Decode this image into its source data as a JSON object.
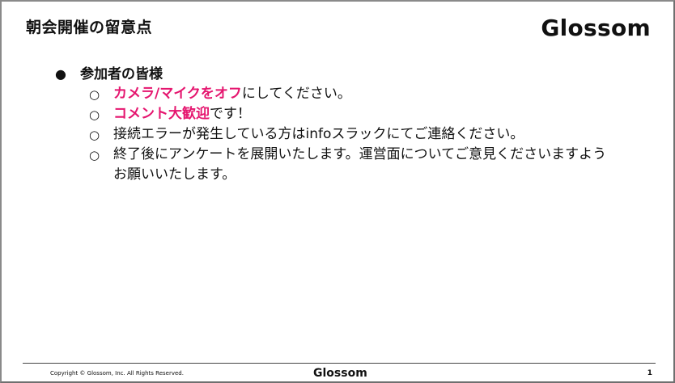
{
  "slide": {
    "title": "朝会開催の留意点",
    "logo": "Glossom"
  },
  "content": {
    "heading": "参加者の皆様",
    "heading_bullet": "●",
    "sub_bullet": "○",
    "items": [
      {
        "highlight": "カメラ/マイクをオフ",
        "text": "にしてください。"
      },
      {
        "highlight": "コメント大歓迎",
        "text": "です！"
      },
      {
        "highlight": "",
        "text": "接続エラーが発生している方はinfoスラックにてご連絡ください。"
      },
      {
        "highlight": "",
        "text": "終了後にアンケートを展開いたします。運営面についてご意見くださいますようお願いいたします。"
      }
    ]
  },
  "footer": {
    "copyright": "Copyright © Glossom, Inc. All Rights Reserved.",
    "logo": "Glossom",
    "page_number": "1"
  },
  "colors": {
    "highlight": "#e5166f",
    "text": "#111111",
    "border": "#8a8a8a"
  }
}
